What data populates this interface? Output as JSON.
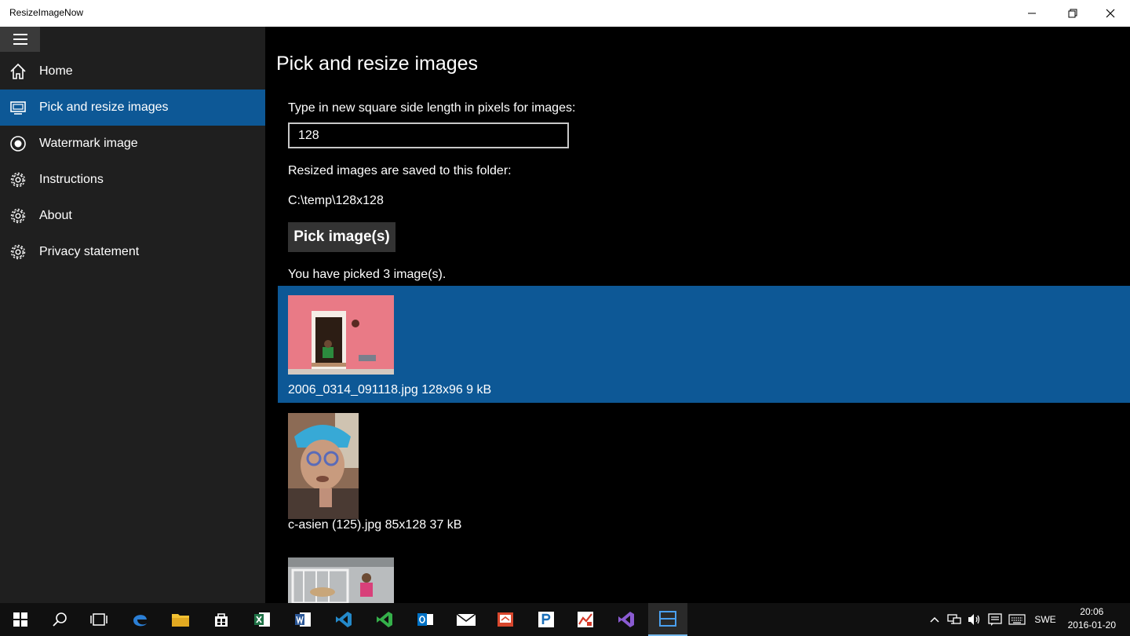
{
  "window": {
    "title": "ResizeImageNow"
  },
  "sidebar": {
    "items": [
      {
        "label": "Home",
        "icon": "home-icon"
      },
      {
        "label": "Pick and resize images",
        "icon": "display-icon",
        "active": true
      },
      {
        "label": "Watermark image",
        "icon": "radio-icon"
      },
      {
        "label": "Instructions",
        "icon": "gear-icon"
      },
      {
        "label": "About",
        "icon": "gear-icon"
      },
      {
        "label": "Privacy statement",
        "icon": "gear-icon"
      }
    ]
  },
  "main": {
    "title": "Pick and resize images",
    "size_label": "Type in new square side length in pixels for images:",
    "size_value": "128",
    "folder_label": "Resized images are saved to this folder:",
    "folder_path": "C:\\temp\\128x128",
    "pick_button": "Pick image(s)",
    "picked_status": "You have picked 3 image(s).",
    "images": [
      {
        "caption": "2006_0314_091118.jpg 128x96 9 kB",
        "selected": true
      },
      {
        "caption": "c-asien (125).jpg 85x128 37 kB",
        "selected": false
      },
      {
        "caption": "",
        "selected": false
      }
    ]
  },
  "taskbar": {
    "language": "SWE",
    "time": "20:06",
    "date": "2016-01-20"
  },
  "colors": {
    "accent": "#0d5896",
    "sidebar_bg": "#1f1f1f",
    "main_bg": "#000000"
  }
}
